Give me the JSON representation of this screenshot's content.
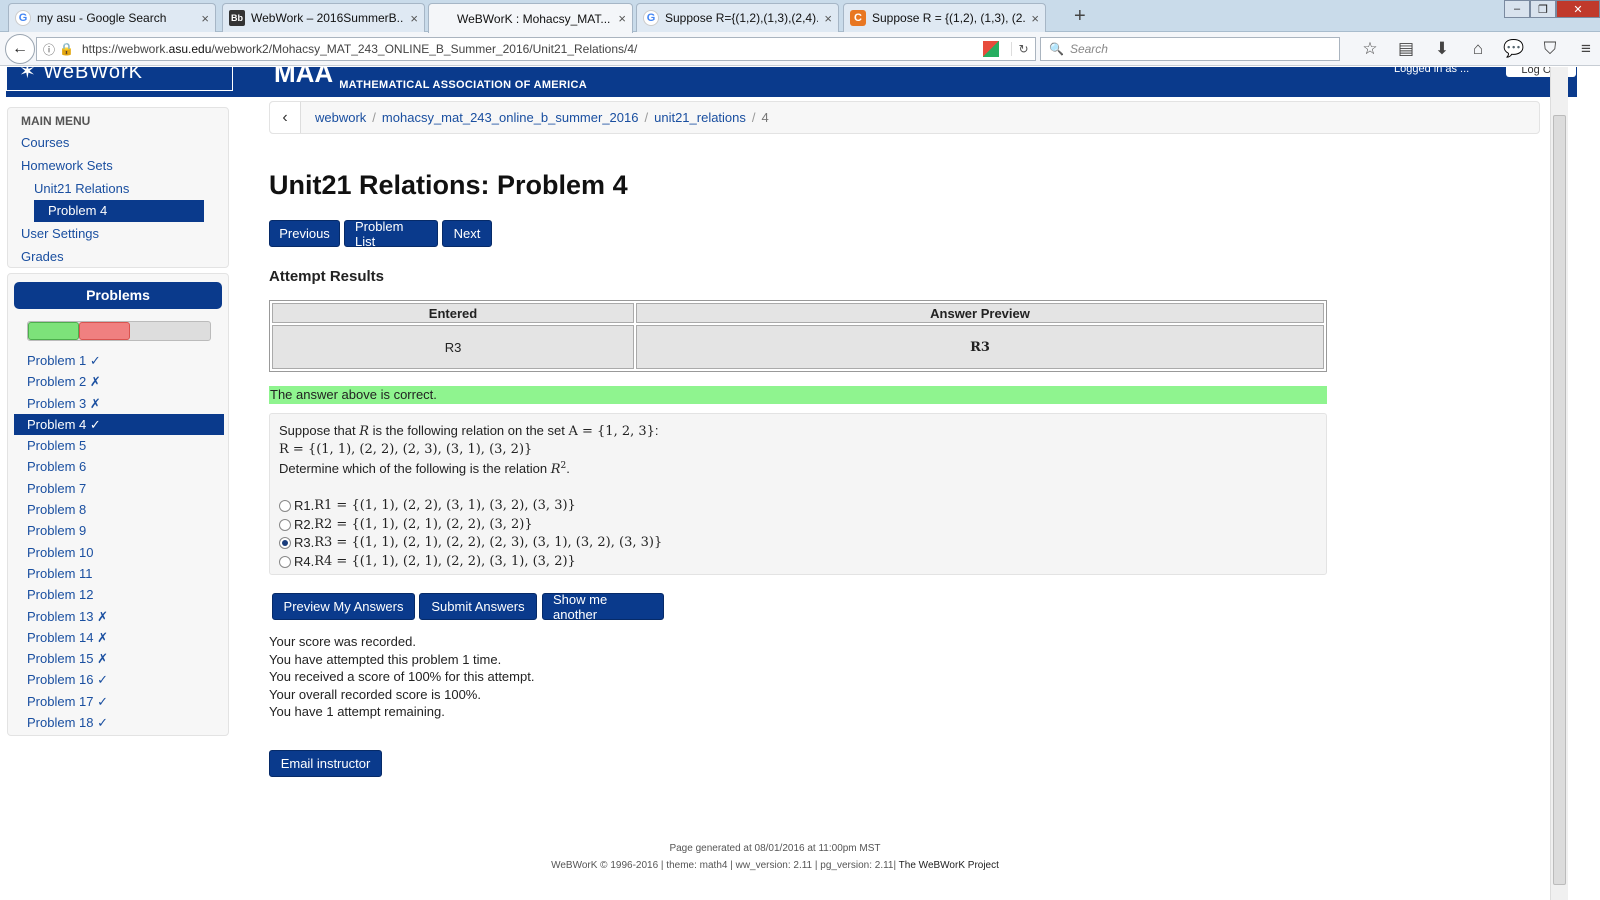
{
  "browser": {
    "tabs": [
      {
        "title": "my asu - Google Search",
        "favicon": "google-icon",
        "active": false
      },
      {
        "title": "WebWork – 2016SummerB...",
        "favicon": "blackboard-icon",
        "active": false
      },
      {
        "title": "WeBWorK : Mohacsy_MAT...",
        "favicon": "",
        "active": true
      },
      {
        "title": "Suppose R={(1,2),(1,3),(2,4)...",
        "favicon": "google-icon",
        "active": false
      },
      {
        "title": "Suppose R = {(1,2), (1,3), (2...",
        "favicon": "chegg-icon",
        "active": false
      }
    ],
    "url_prefix": "https://webwork.",
    "url_domain": "asu.edu",
    "url_path": "/webwork2/Mohacsy_MAT_243_ONLINE_B_Summer_2016/Unit21_Relations/4/",
    "search_placeholder": "Search"
  },
  "banner": {
    "logo_text": "WeBWorK",
    "maa_text": "MAA",
    "maa_subtitle": "MATHEMATICAL ASSOCIATION OF AMERICA",
    "login_text": "Logged in as ...",
    "logout_label": "Log Out"
  },
  "sidebar": {
    "main_menu_label": "MAIN MENU",
    "courses": "Courses",
    "homework_sets": "Homework Sets",
    "set_name": "Unit21 Relations",
    "current_problem": "Problem 4",
    "user_settings": "User Settings",
    "grades": "Grades",
    "problems_header": "Problems",
    "progress": {
      "correct_fraction": 0.28,
      "incorrect_fraction": 0.28
    },
    "problems": [
      "Problem 1 ✓",
      "Problem 2 ✗",
      "Problem 3 ✗",
      "Problem 4 ✓",
      "Problem 5",
      "Problem 6",
      "Problem 7",
      "Problem 8",
      "Problem 9",
      "Problem 10",
      "Problem 11",
      "Problem 12",
      "Problem 13 ✗",
      "Problem 14 ✗",
      "Problem 15 ✗",
      "Problem 16 ✓",
      "Problem 17 ✓",
      "Problem 18 ✓"
    ],
    "active_problem_index": 3
  },
  "breadcrumb": {
    "items": [
      "webwork",
      "mohacsy_mat_243_online_b_summer_2016",
      "unit21_relations"
    ],
    "current": "4"
  },
  "main": {
    "title": "Unit21 Relations: Problem 4",
    "nav_buttons": {
      "previous": "Previous",
      "problem_list": "Problem List",
      "next": "Next"
    },
    "attempt_heading": "Attempt Results",
    "results_table": {
      "headers": [
        "Entered",
        "Answer Preview"
      ],
      "row": [
        "R3",
        "R3"
      ]
    },
    "correct_message": "The answer above is correct.",
    "problem": {
      "intro_1": "Suppose that ",
      "var_R": "R",
      "intro_2": " is the following relation on the set ",
      "set_A": "A = {1, 2, 3}",
      "colon": ":",
      "relation": "R = {(1, 1), (2, 2), (2, 3), (3, 1), (3, 2)}",
      "question_1": "Determine which of the following is the relation ",
      "r_squared": "R",
      "sup": "2",
      "period": ".",
      "options": [
        {
          "label": "R1. ",
          "math": "R1 = {(1, 1), (2, 2), (3, 1), (3, 2), (3, 3)}",
          "selected": false
        },
        {
          "label": "R2. ",
          "math": "R2 = {(1, 1), (2, 1), (2, 2), (3, 2)}",
          "selected": false
        },
        {
          "label": "R3. ",
          "math": "R3 = {(1, 1), (2, 1), (2, 2), (2, 3), (3, 1), (3, 2), (3, 3)}",
          "selected": true
        },
        {
          "label": "R4. ",
          "math": "R4 = {(1, 1), (2, 1), (2, 2), (3, 1), (3, 2)}",
          "selected": false
        }
      ]
    },
    "action_buttons": {
      "preview": "Preview My Answers",
      "submit": "Submit Answers",
      "another": "Show me another"
    },
    "score_messages": [
      "Your score was recorded.",
      "You have attempted this problem 1 time.",
      "You received a score of 100% for this attempt.",
      "Your overall recorded score is 100%.",
      "You have 1 attempt remaining."
    ],
    "email_button": "Email instructor"
  },
  "footer": {
    "generated": "Page generated at 08/01/2016 at 11:00pm MST",
    "versions": "WeBWorK © 1996-2016 | theme: math4 | ww_version: 2.11 | pg_version: 2.11| ",
    "project": "The WeBWorK Project"
  }
}
